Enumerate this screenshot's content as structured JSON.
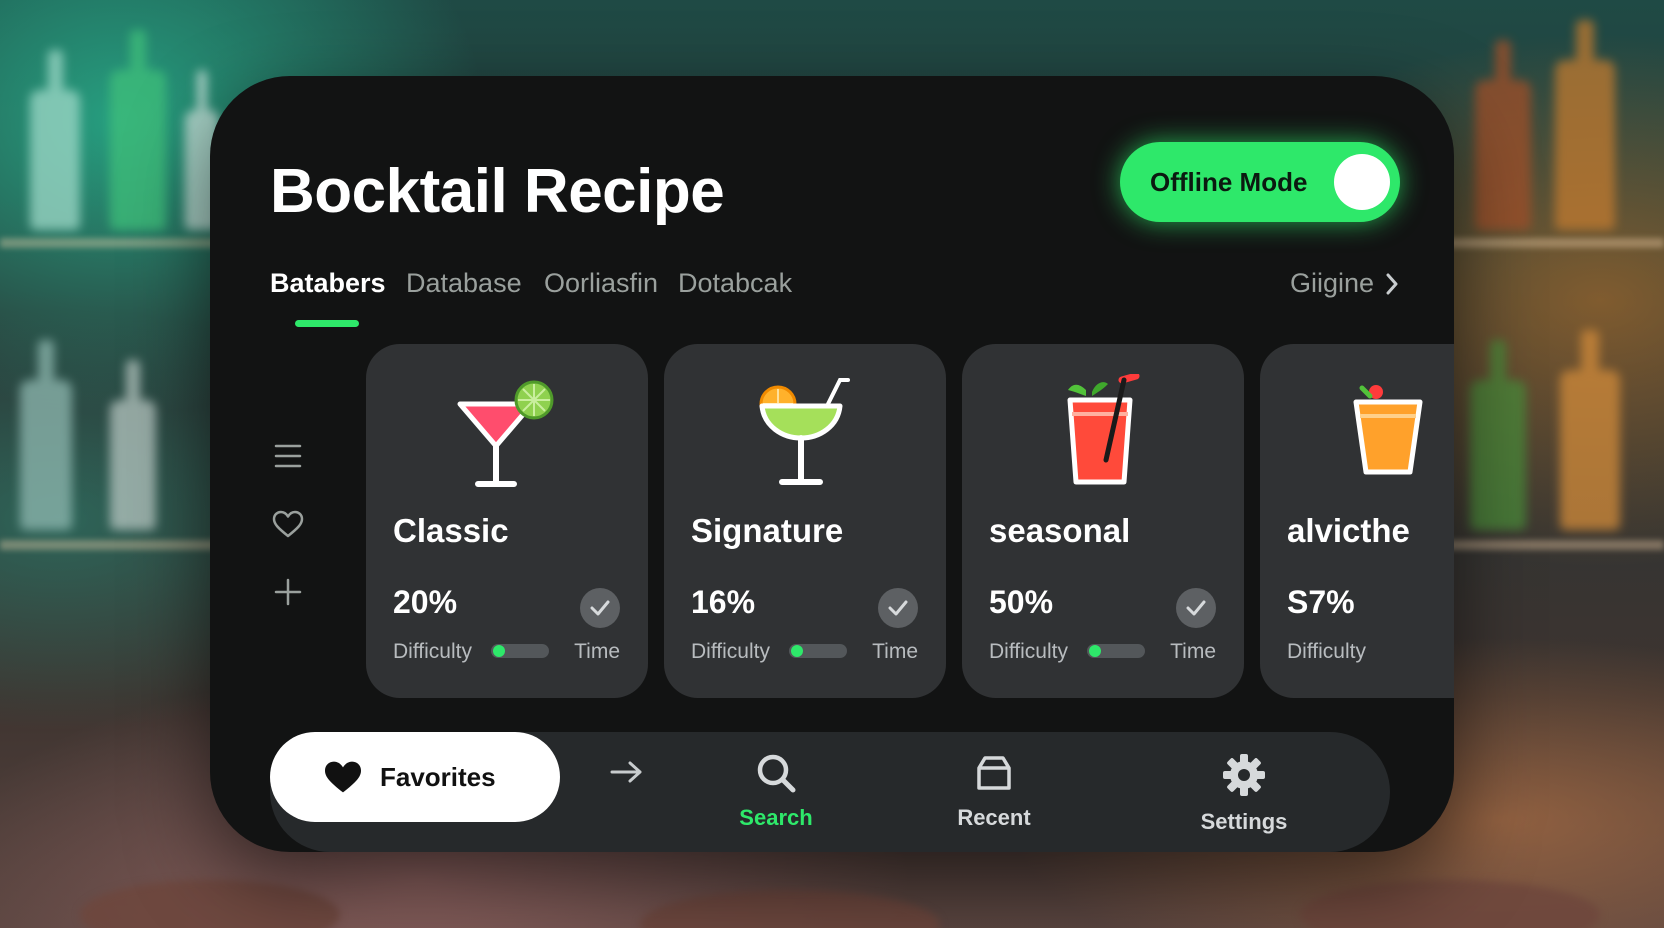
{
  "app": {
    "title": "Bocktail Recipe"
  },
  "offline_toggle": {
    "label": "Offline Mode",
    "on": true
  },
  "tabs": [
    {
      "label": "Batabers",
      "active": true
    },
    {
      "label": "Database",
      "active": false
    },
    {
      "label": "Oorliasfin",
      "active": false
    },
    {
      "label": "Dotabcak",
      "active": false
    }
  ],
  "tabs_more": {
    "label": "Giigine",
    "icon": "chevron-right-icon"
  },
  "sidebar": [
    {
      "icon": "menu-icon"
    },
    {
      "icon": "heart-outline-icon"
    },
    {
      "icon": "plus-icon"
    }
  ],
  "cards": [
    {
      "name": "Classic",
      "percent": "20%",
      "difficulty_label": "Difficulty",
      "time_label": "Time",
      "difficulty_level": 0.15,
      "icon": "martini-glass-icon"
    },
    {
      "name": "Signature",
      "percent": "16%",
      "difficulty_label": "Difficulty",
      "time_label": "Time",
      "difficulty_level": 0.15,
      "icon": "margarita-glass-icon"
    },
    {
      "name": "seasonal",
      "percent": "50%",
      "difficulty_label": "Difficulty",
      "time_label": "Time",
      "difficulty_level": 0.15,
      "icon": "highball-glass-icon"
    },
    {
      "name": "alvicthe",
      "percent": "S7%",
      "difficulty_label": "Difficulty",
      "time_label": "",
      "difficulty_level": 0,
      "icon": "cocktail-glass-icon"
    }
  ],
  "bottom_nav": {
    "favorites": {
      "label": "Favorites",
      "icon": "heart-filled-icon"
    },
    "arrow": {
      "icon": "arrow-right-icon"
    },
    "items": [
      {
        "label": "Search",
        "icon": "search-icon",
        "active": true
      },
      {
        "label": "Recent",
        "icon": "folder-icon",
        "active": false
      },
      {
        "label": "Settings",
        "icon": "gear-icon",
        "active": false
      }
    ]
  },
  "colors": {
    "accent": "#2ee86a",
    "panel": "#121313",
    "card": "#303234",
    "nav_bar": "#26292b"
  }
}
